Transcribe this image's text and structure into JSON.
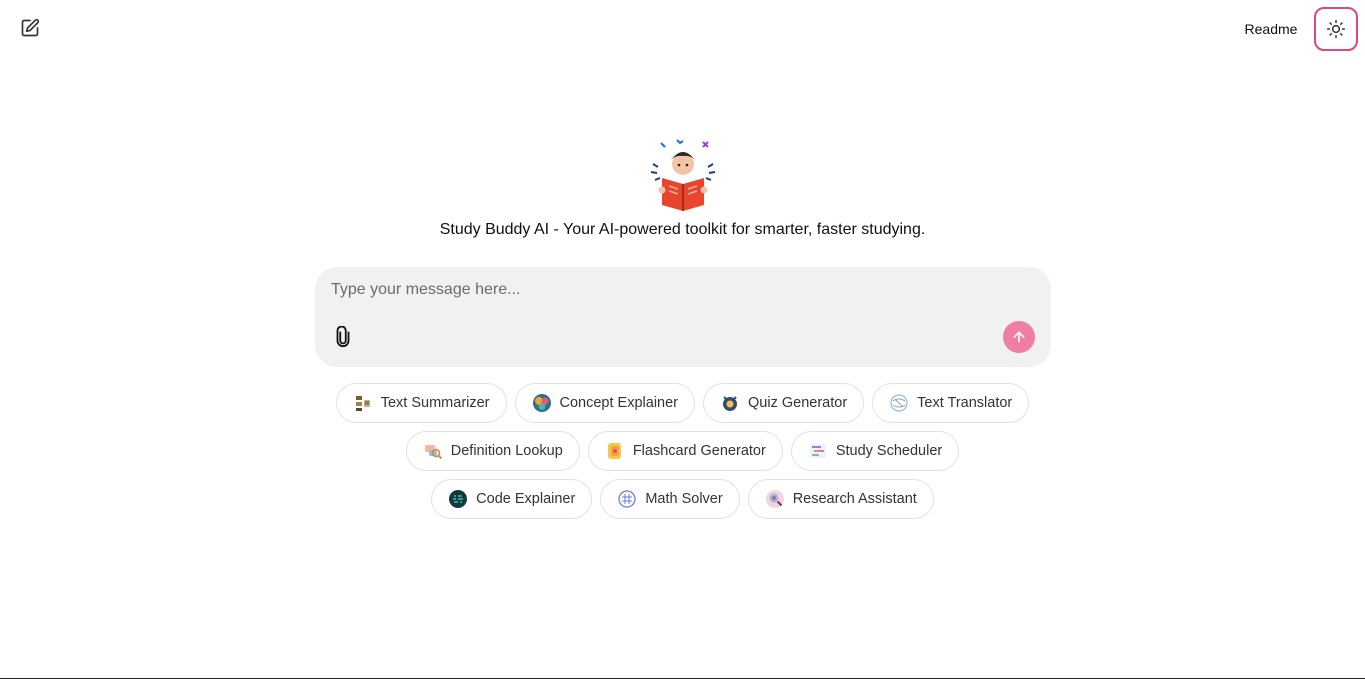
{
  "header": {
    "new_chat_icon": "pencil-square-icon",
    "readme_label": "Readme",
    "theme_icon": "sun-icon",
    "theme_accent": "#e0457b"
  },
  "hero": {
    "mascot": "student-reading-book-illustration",
    "tagline": "Study Buddy AI - Your AI-powered toolkit for smarter, faster studying."
  },
  "composer": {
    "placeholder": "Type your message here...",
    "value": "",
    "attach_icon": "paperclip-icon",
    "send_icon": "arrow-up-icon",
    "send_color": "#f07ea3",
    "background": "#f1f1f1"
  },
  "tools": [
    {
      "label": "Text Summarizer",
      "icon": "summarizer-icon"
    },
    {
      "label": "Concept Explainer",
      "icon": "concept-icon"
    },
    {
      "label": "Quiz Generator",
      "icon": "quiz-icon"
    },
    {
      "label": "Text Translator",
      "icon": "translator-icon"
    },
    {
      "label": "Definition Lookup",
      "icon": "definition-icon"
    },
    {
      "label": "Flashcard Generator",
      "icon": "flashcard-icon"
    },
    {
      "label": "Study Scheduler",
      "icon": "scheduler-icon"
    },
    {
      "label": "Code Explainer",
      "icon": "code-icon"
    },
    {
      "label": "Math Solver",
      "icon": "math-icon"
    },
    {
      "label": "Research Assistant",
      "icon": "research-icon"
    }
  ]
}
